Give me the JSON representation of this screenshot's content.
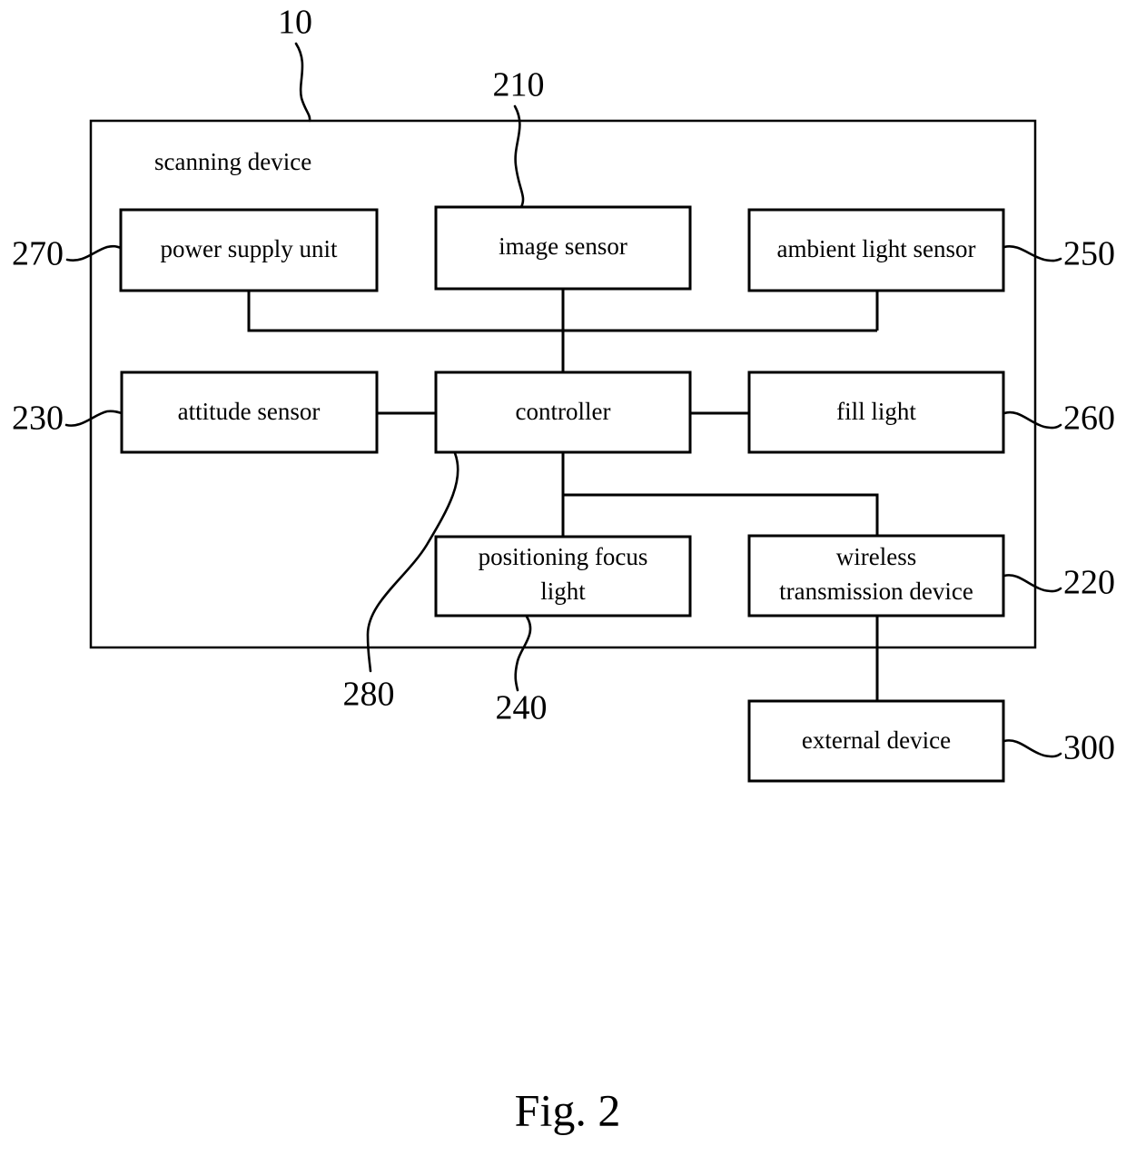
{
  "figure": {
    "caption": "Fig. 2",
    "container_label": "scanning device",
    "container_ref": "10"
  },
  "blocks": [
    {
      "id": "power_supply_unit",
      "label": "power supply unit",
      "ref": "270"
    },
    {
      "id": "image_sensor",
      "label": "image sensor",
      "ref": "210"
    },
    {
      "id": "ambient_light_sensor",
      "label": "ambient light sensor",
      "ref": "250"
    },
    {
      "id": "attitude_sensor",
      "label": "attitude sensor",
      "ref": "230"
    },
    {
      "id": "controller",
      "label": "controller",
      "ref": "280"
    },
    {
      "id": "fill_light",
      "label": "fill light",
      "ref": "260"
    },
    {
      "id": "positioning_focus_light",
      "label_line1": "positioning focus",
      "label_line2": "light",
      "ref": "240"
    },
    {
      "id": "wireless_transmission",
      "label_line1": "wireless",
      "label_line2": "transmission device",
      "ref": "220"
    },
    {
      "id": "external_device",
      "label": "external device",
      "ref": "300"
    }
  ],
  "reference_numbers": {
    "scanning_device": "10",
    "image_sensor": "210",
    "wireless_transmission_device": "220",
    "attitude_sensor": "230",
    "positioning_focus_light": "240",
    "ambient_light_sensor": "250",
    "fill_light": "260",
    "power_supply_unit": "270",
    "controller": "280",
    "external_device": "300"
  },
  "connections": [
    {
      "from": "power_supply_unit",
      "to": "bus"
    },
    {
      "from": "image_sensor",
      "to": "controller"
    },
    {
      "from": "ambient_light_sensor",
      "to": "bus"
    },
    {
      "from": "attitude_sensor",
      "to": "controller"
    },
    {
      "from": "controller",
      "to": "fill_light"
    },
    {
      "from": "controller",
      "to": "positioning_focus_light"
    },
    {
      "from": "controller",
      "to": "wireless_transmission"
    },
    {
      "from": "wireless_transmission",
      "to": "external_device"
    }
  ],
  "colors": {
    "stroke": "#000000",
    "fill": "#ffffff",
    "background": "#ffffff"
  }
}
